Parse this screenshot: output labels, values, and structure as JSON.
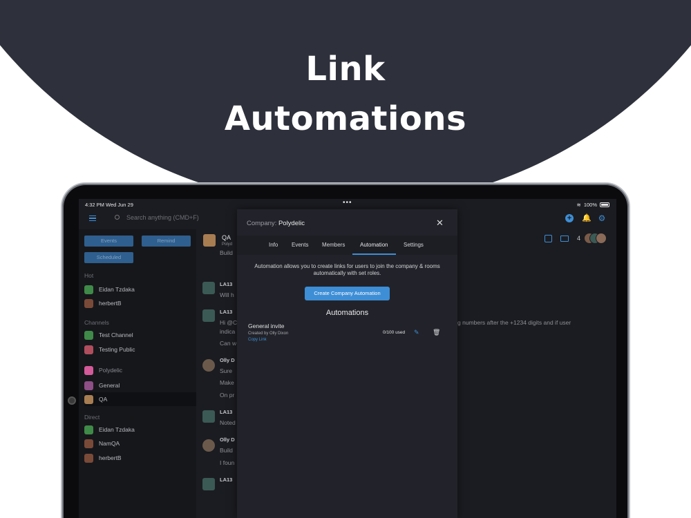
{
  "hero": {
    "line1": "Link",
    "line2": "Automations"
  },
  "status": {
    "time": "4:32 PM  Wed Jun 29",
    "dots": "•••",
    "battery": "100%"
  },
  "topbar": {
    "search_placeholder": "Search anything (CMD+F)",
    "plus": "+",
    "bell": "🔔",
    "gear": "⚙"
  },
  "sidebar": {
    "buttons": {
      "events": "Events",
      "remind": "Remind",
      "scheduled": "Scheduled"
    },
    "sections": {
      "hot": "Hot",
      "channels": "Channels",
      "direct": "Direct"
    },
    "hot": [
      {
        "label": "Eidan Tzdaka",
        "color": "#3f8a48"
      },
      {
        "label": "herbertB",
        "color": "#7a4a38"
      }
    ],
    "channels": [
      {
        "label": "Test Channel",
        "color": "#3f8a48"
      },
      {
        "label": "Testing Public",
        "color": "#b04e5e"
      }
    ],
    "company": {
      "label": "Polydelic",
      "color": "#d45a9a"
    },
    "rooms": [
      {
        "label": "General",
        "color": "#8e4e86"
      },
      {
        "label": "QA",
        "color": "#a87d52"
      }
    ],
    "direct": [
      {
        "label": "Eidan Tzdaka",
        "color": "#3f8a48"
      },
      {
        "label": "NamQA",
        "color": "#7a4a38"
      },
      {
        "label": "herbertB",
        "color": "#7a4a38"
      }
    ]
  },
  "chat": {
    "room_name": "QA",
    "room_sub": "Polyd",
    "member_count": "4",
    "messages": [
      {
        "name": "",
        "line": "Build"
      },
      {
        "name": "LA13",
        "line": "Will h"
      },
      {
        "name": "LA13",
        "line": "Hi @C",
        "line2": "indica",
        "line3": "Can w"
      },
      {
        "name": "Olly D",
        "line": "Sure",
        "line2": "Make",
        "line3": "On pr"
      },
      {
        "name": "LA13",
        "line": "Noted"
      },
      {
        "name": "Olly D",
        "line": "Build",
        "line2": "I foun"
      },
      {
        "name": "LA13",
        "line": ""
      }
    ],
    "right_text": "g numbers after the +1234 digits and if user"
  },
  "modal": {
    "title_prefix": "Company:",
    "title_company": "Polydelic",
    "close": "✕",
    "tabs": [
      "Info",
      "Events",
      "Members",
      "Automation",
      "Settings"
    ],
    "description": "Automation allows you to create links for users to join the company & rooms automatically with set roles.",
    "create_button": "Create Company Automation",
    "heading": "Automations",
    "automation": {
      "name": "General invite",
      "created_by": "Created by Olly Dixon",
      "copy_link": "Copy Link",
      "used": "0/100 used",
      "edit": "✎",
      "delete": "🗑"
    }
  }
}
